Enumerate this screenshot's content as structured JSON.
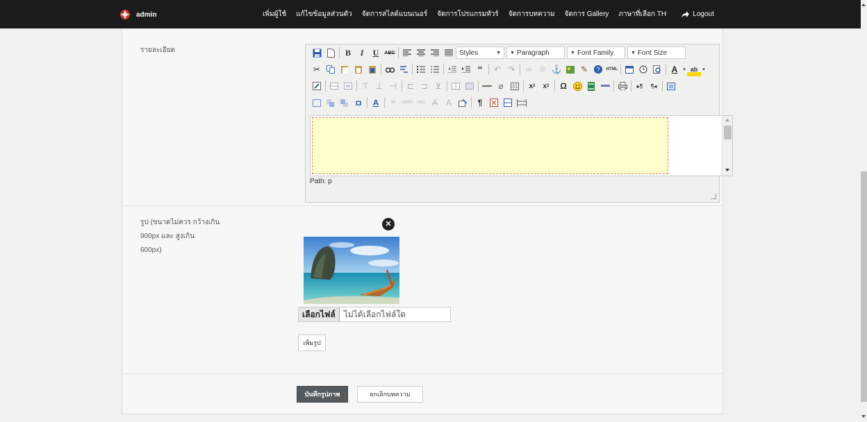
{
  "navbar": {
    "brand": "admin",
    "items": [
      {
        "label": "เพิ่มผู้ใช้"
      },
      {
        "label": "แก้ไขข้อมูลส่วนตัว"
      },
      {
        "label": "จัดการสไลด์แบนเนอร์"
      },
      {
        "label": "จัดการโปรแกรมทัวร์"
      },
      {
        "label": "จัดการบทความ"
      },
      {
        "label": "จัดการ Gallery"
      },
      {
        "label": "ภาษาที่เลือก TH"
      }
    ],
    "logout": "Logout"
  },
  "form": {
    "detail_label": "รายละเอียด",
    "editor": {
      "styles": "Styles",
      "format": "Paragraph",
      "font_family": "Font Family",
      "font_size": "Font Size",
      "path": "Path: p"
    },
    "image_label_line1": "รูป (ขนาดไม่ควร กว้างเกิน",
    "image_label_line2": "900px และ สูงเกิน",
    "image_label_line3": "600px)",
    "file_button": "เลือกไฟล์",
    "file_status": "ไม่ได้เลือกไฟล์ใด",
    "add_image": "เพิ่มรูป",
    "save": "บันทึกรูปภาพ",
    "cancel": "ยกเลิกบทความ"
  },
  "colors": {
    "navbar_bg": "#1b1b1b",
    "editor_content_bg": "#ffffcc",
    "primary_button": "#555a5f"
  }
}
